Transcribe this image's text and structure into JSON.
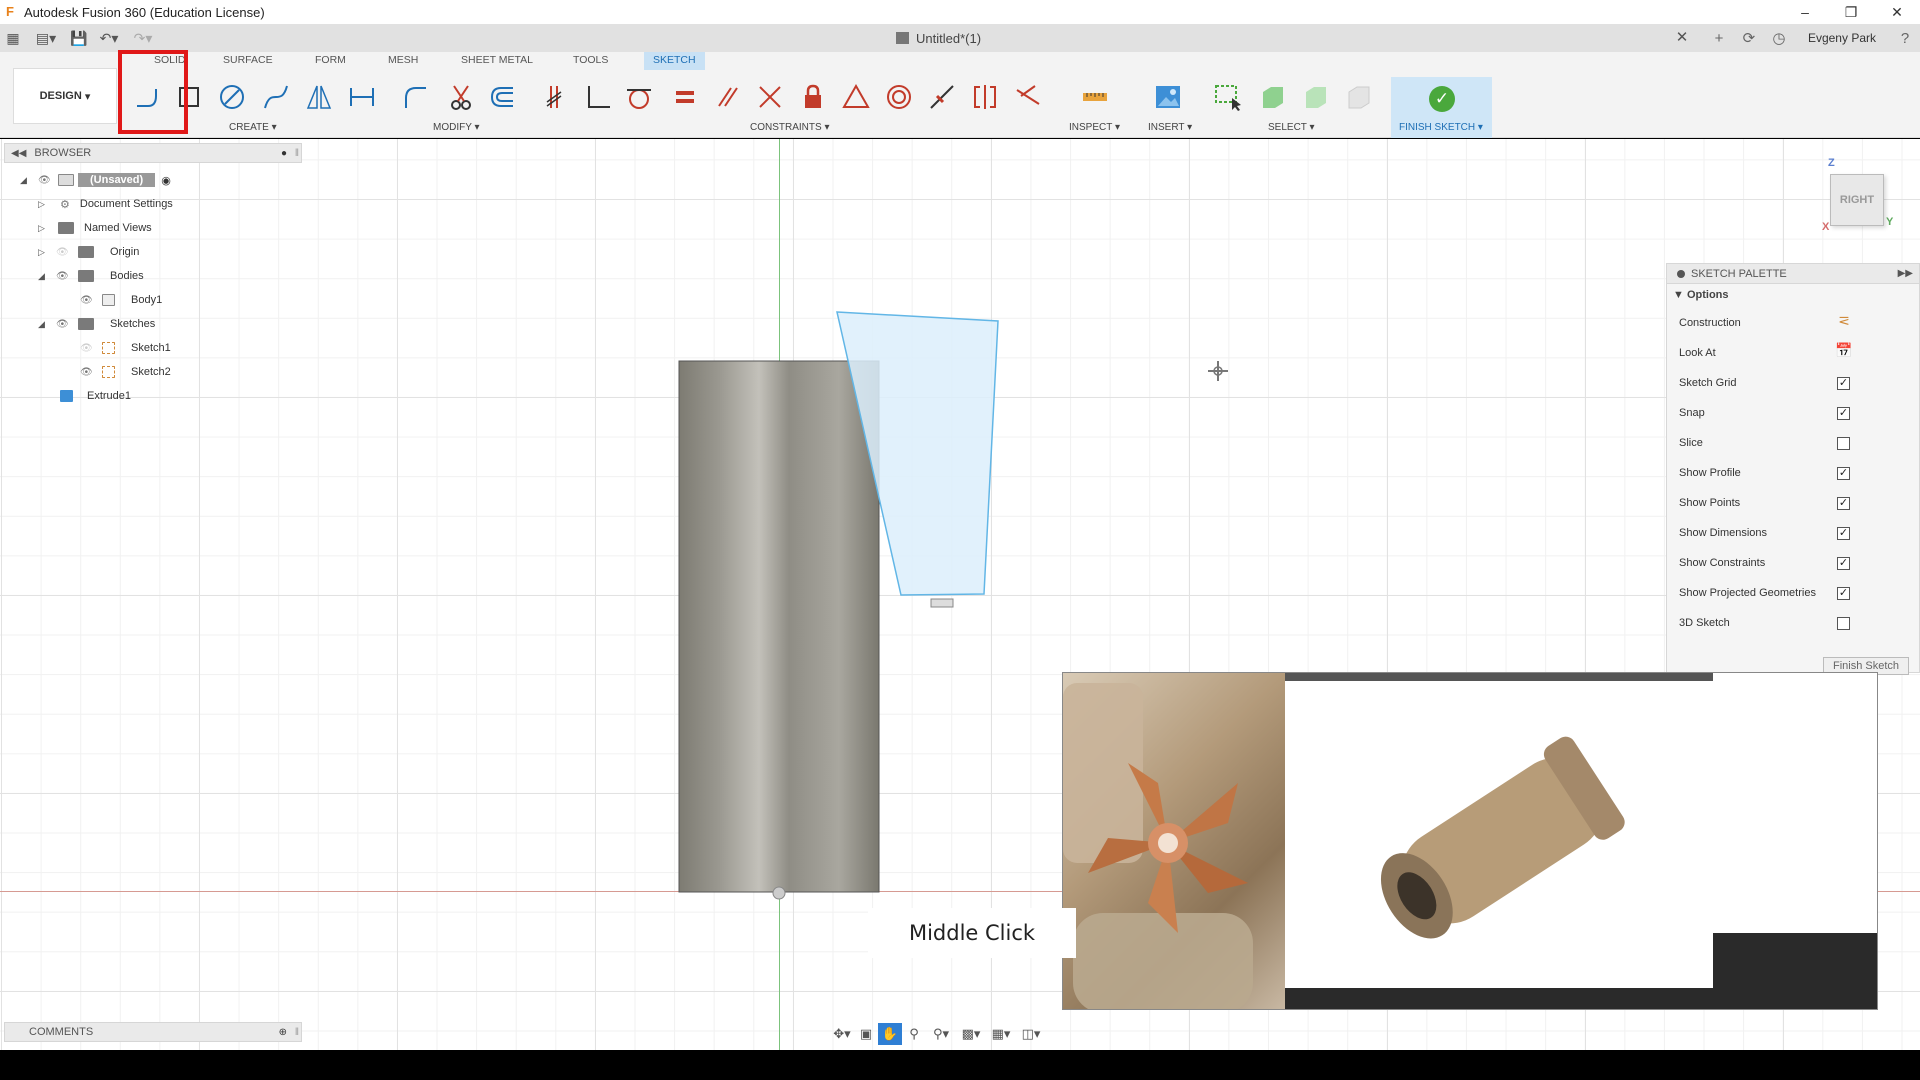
{
  "window": {
    "title": "Autodesk Fusion 360 (Education License)",
    "controls": [
      "minimize",
      "restore",
      "close"
    ]
  },
  "quick_access": {
    "document_title": "Untitled*(1)",
    "user_name": "Evgeny Park"
  },
  "ribbon": {
    "workspace_label": "DESIGN",
    "tabs": [
      {
        "label": "SOLID",
        "active": false
      },
      {
        "label": "SURFACE",
        "active": false
      },
      {
        "label": "FORM",
        "active": false
      },
      {
        "label": "MESH",
        "active": false
      },
      {
        "label": "SHEET METAL",
        "active": false
      },
      {
        "label": "TOOLS",
        "active": false
      },
      {
        "label": "SKETCH",
        "active": true
      }
    ],
    "groups": {
      "create": "CREATE",
      "modify": "MODIFY",
      "constraints": "CONSTRAINTS",
      "inspect": "INSPECT",
      "insert": "INSERT",
      "select": "SELECT",
      "finish": "FINISH SKETCH"
    }
  },
  "browser": {
    "header": "BROWSER",
    "items": [
      {
        "label": "(Unsaved)"
      },
      {
        "label": "Document Settings"
      },
      {
        "label": "Named Views"
      },
      {
        "label": "Origin"
      },
      {
        "label": "Bodies"
      },
      {
        "label": "Body1"
      },
      {
        "label": "Sketches"
      },
      {
        "label": "Sketch1"
      },
      {
        "label": "Sketch2"
      },
      {
        "label": "Extrude1"
      }
    ]
  },
  "viewcube": {
    "face": "RIGHT",
    "axes": {
      "z": "Z",
      "y": "Y",
      "x": "X"
    }
  },
  "sketch_palette": {
    "title": "SKETCH PALETTE",
    "section": "Options",
    "rows": [
      {
        "label": "Construction",
        "type": "icon"
      },
      {
        "label": "Look At",
        "type": "icon"
      },
      {
        "label": "Sketch Grid",
        "type": "checkbox",
        "checked": true
      },
      {
        "label": "Snap",
        "type": "checkbox",
        "checked": true
      },
      {
        "label": "Slice",
        "type": "checkbox",
        "checked": false
      },
      {
        "label": "Show Profile",
        "type": "checkbox",
        "checked": true
      },
      {
        "label": "Show Points",
        "type": "checkbox",
        "checked": true
      },
      {
        "label": "Show Dimensions",
        "type": "checkbox",
        "checked": true
      },
      {
        "label": "Show Constraints",
        "type": "checkbox",
        "checked": true
      },
      {
        "label": "Show Projected Geometries",
        "type": "checkbox",
        "checked": true
      },
      {
        "label": "3D Sketch",
        "type": "checkbox",
        "checked": false
      }
    ],
    "finish_button": "Finish Sketch"
  },
  "comments": {
    "header": "COMMENTS"
  },
  "overlay": {
    "caption": "Middle Click"
  },
  "colors": {
    "accent": "#1e6fb5",
    "highlight_box": "#e01818",
    "finish_check": "#4aa83c",
    "sketch_profile_fill": "#dceefb",
    "sketch_profile_stroke": "#62b6e6"
  }
}
